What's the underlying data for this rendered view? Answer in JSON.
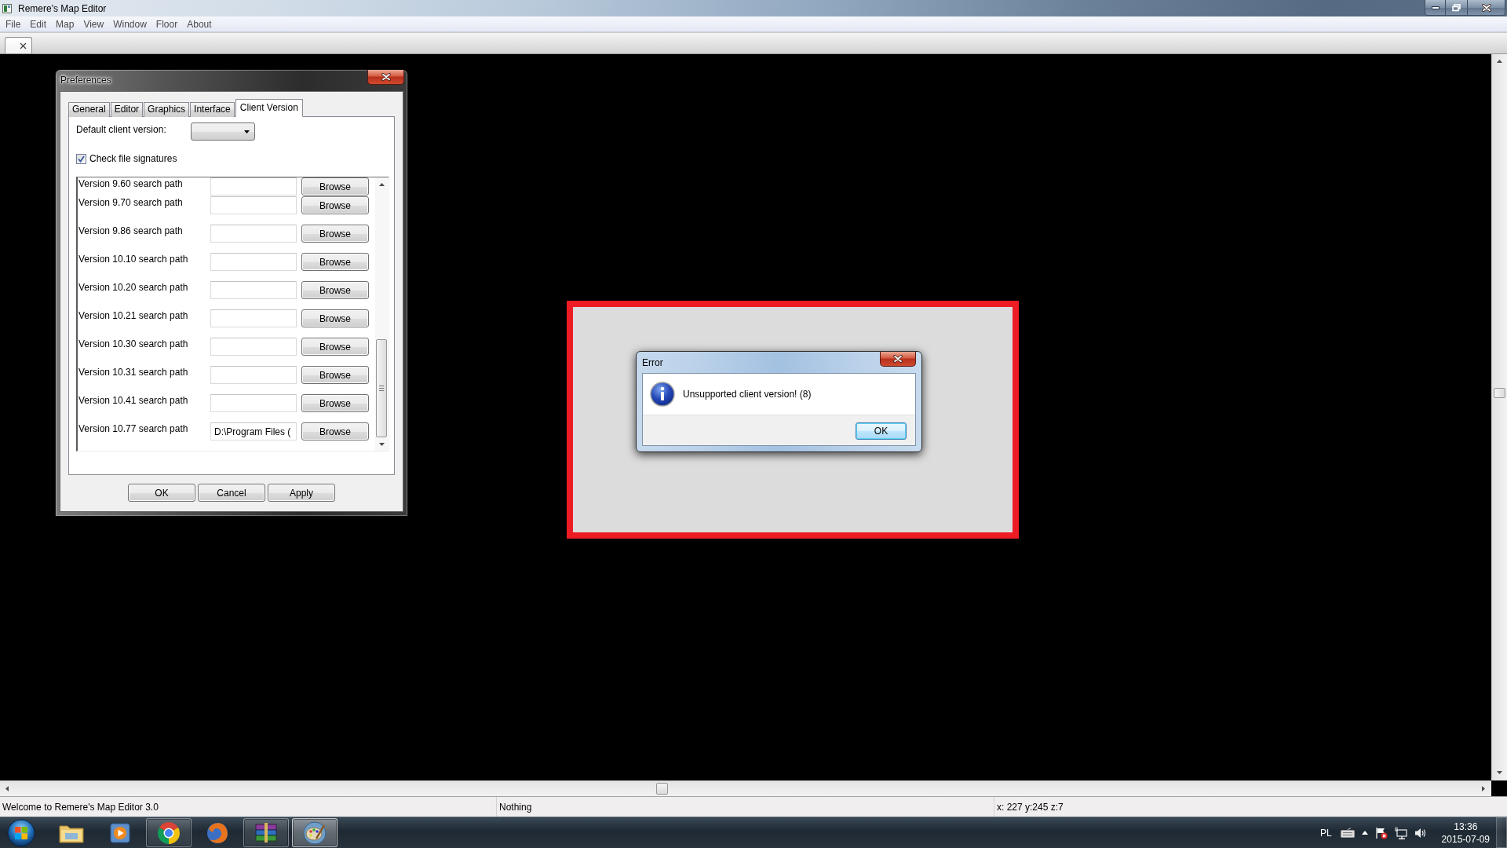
{
  "window": {
    "title": "Remere's Map Editor"
  },
  "menu": [
    "File",
    "Edit",
    "Map",
    "View",
    "Window",
    "Floor",
    "About"
  ],
  "editor_tabs": [
    {
      "selected": true
    }
  ],
  "preferences_dialog": {
    "title": "Preferences",
    "tabs": [
      {
        "label": "General",
        "selected": false
      },
      {
        "label": "Editor",
        "selected": false
      },
      {
        "label": "Graphics",
        "selected": false
      },
      {
        "label": "Interface",
        "selected": false
      },
      {
        "label": "Client Version",
        "selected": true
      }
    ],
    "default_client_version": {
      "label": "Default client version:"
    },
    "check_file_signatures": {
      "label": "Check file signatures",
      "checked": true
    },
    "search_paths": [
      {
        "label": "Version 9.60 search path",
        "button": "Browse"
      },
      {
        "label": "Version 9.70 search path",
        "button": "Browse"
      },
      {
        "label": "Version 9.86 search path",
        "button": "Browse"
      },
      {
        "label": "Version 10.10 search path",
        "button": "Browse"
      },
      {
        "label": "Version 10.20 search path",
        "button": "Browse"
      },
      {
        "label": "Version 10.21 search path",
        "button": "Browse"
      },
      {
        "label": "Version 10.30 search path",
        "button": "Browse"
      },
      {
        "label": "Version 10.31 search path",
        "button": "Browse"
      },
      {
        "label": "Version 10.41 search path",
        "button": "Browse"
      },
      {
        "label": "Version 10.77 search path",
        "value": "D:\\Program Files (",
        "button": "Browse"
      }
    ],
    "buttons": [
      {
        "label": "OK",
        "focused": false
      },
      {
        "label": "Cancel",
        "focused": false
      },
      {
        "label": "Apply",
        "focused": false
      }
    ]
  },
  "error_dialog": {
    "title": "Error",
    "message": "Unsupported client version! (8)",
    "buttons": [
      {
        "label": "OK",
        "focused": true
      }
    ]
  },
  "status_bar": [
    "Welcome to Remere's Map Editor 3.0",
    "Nothing",
    "x: 227 y:245 z:7"
  ],
  "taskbar": {
    "apps": [
      {
        "kind": "folder",
        "running": false,
        "selected": false
      },
      {
        "kind": "media",
        "running": false,
        "selected": false
      },
      {
        "kind": "ring",
        "running": true,
        "selected": false
      },
      {
        "kind": "globe",
        "running": false,
        "selected": false
      },
      {
        "kind": "archive",
        "running": true,
        "selected": false
      },
      {
        "kind": "palette",
        "running": true,
        "selected": true
      }
    ],
    "tray": {
      "language": "PL",
      "time": "13:36",
      "date": "2015-07-09"
    }
  }
}
